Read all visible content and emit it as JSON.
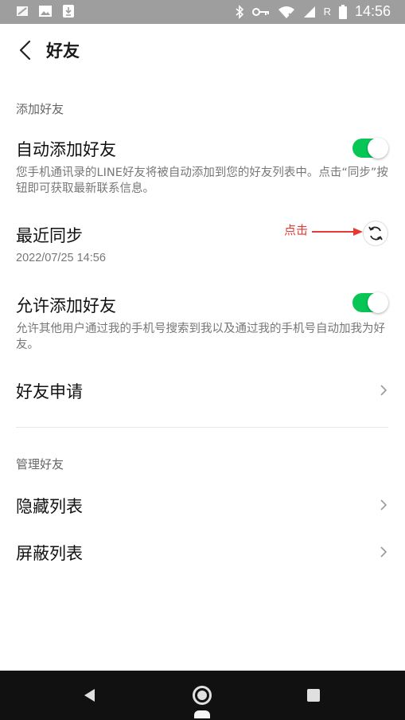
{
  "status_bar": {
    "time": "14:56",
    "network_letter": "R",
    "icons": [
      "signal-off-icon",
      "image-icon",
      "download-icon",
      "bluetooth-icon",
      "vpn-key-icon",
      "wifi-off-icon",
      "signal-icon",
      "battery-icon"
    ]
  },
  "header": {
    "title": "好友",
    "back_icon": "back-arrow-icon"
  },
  "add_friends": {
    "section_label": "添加好友",
    "auto_add": {
      "title": "自动添加好友",
      "description": "您手机通讯录的LINE好友将被自动添加到您的好友列表中。点击“同步”按钮即可获取最新联系信息。",
      "enabled": true
    },
    "recent_sync": {
      "title": "最近同步",
      "time": "2022/07/25 14:56",
      "annotation": "点击",
      "button_icon": "sync-icon"
    },
    "allow_add": {
      "title": "允许添加好友",
      "description": "允许其他用户通过我的手机号搜索到我以及通过我的手机号自动加我为好友。",
      "enabled": true
    },
    "friend_requests": {
      "title": "好友申请"
    }
  },
  "manage_friends": {
    "section_label": "管理好友",
    "hidden_list": {
      "title": "隐藏列表"
    },
    "blocked_list": {
      "title": "屏蔽列表"
    }
  },
  "colors": {
    "toggle_on": "#06c755",
    "annotation": "#e53935",
    "status_bar": "#9e9e9e",
    "nav_bar": "#111111"
  }
}
